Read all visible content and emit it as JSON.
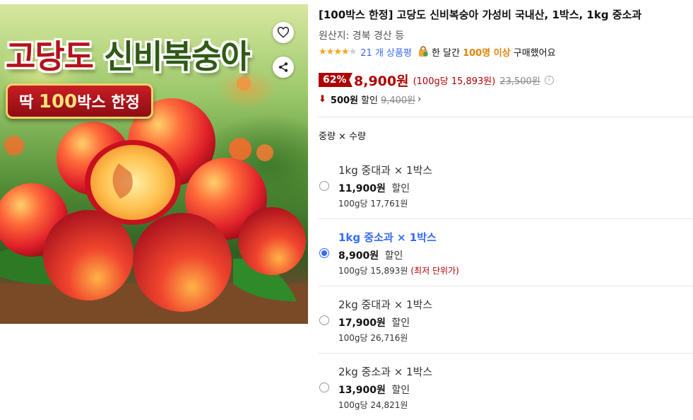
{
  "image": {
    "headline_red": "고당도",
    "headline_green": "신비복숭아",
    "badge_prefix": "딱",
    "badge_number": "100",
    "badge_suffix": "박스 한정",
    "heart_icon": "heart-outline-icon",
    "share_icon": "share-icon"
  },
  "product": {
    "title": "[100박스 한정] 고당도 신비복숭아 가성비 국내산, 1박스, 1kg 중소과",
    "origin": "원산지: 경북 경산 등",
    "rating": 4,
    "rating_max": 5,
    "review_count": "21 개 상품평",
    "buyers_prefix": "한 달간",
    "buyers_highlight": "100명 이상",
    "buyers_suffix": "구매했어요"
  },
  "price": {
    "discount_rate": "62%",
    "sale_price": "8,900원",
    "unit_price": "(100g당 15,893원)",
    "original_price": "23,500원",
    "info_icon": "i",
    "coupon_amount": "500원",
    "coupon_label": "할인",
    "coupon_original": "9,400원",
    "chevron": "›"
  },
  "options": {
    "heading": "중량 × 수량",
    "items": [
      {
        "name": "1kg 중대과 × 1박스",
        "price": "11,900원",
        "discount": "할인",
        "unit": "100g당 17,761원",
        "best": "",
        "selected": false
      },
      {
        "name": "1kg 중소과 × 1박스",
        "price": "8,900원",
        "discount": "할인",
        "unit": "100g당 15,893원",
        "best": "(최저 단위가)",
        "selected": true
      },
      {
        "name": "2kg 중대과 × 1박스",
        "price": "17,900원",
        "discount": "할인",
        "unit": "100g당 26,716원",
        "best": "",
        "selected": false
      },
      {
        "name": "2kg 중소과 × 1박스",
        "price": "13,900원",
        "discount": "할인",
        "unit": "100g당 24,821원",
        "best": "",
        "selected": false
      }
    ]
  },
  "colors": {
    "accent_blue": "#346aff",
    "price_red": "#ae0000",
    "star": "#f5a623",
    "buyers_orange": "#e0840b"
  }
}
